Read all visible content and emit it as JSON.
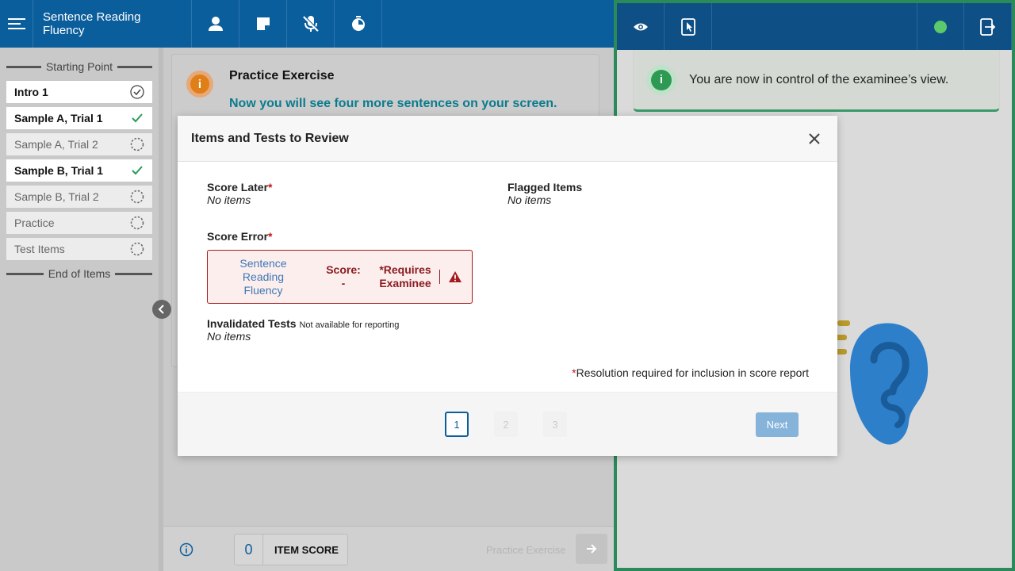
{
  "header": {
    "title": "Sentence Reading Fluency",
    "icons": [
      "menu-icon",
      "person-icon",
      "note-icon",
      "mic-off-icon",
      "timer-icon"
    ]
  },
  "sidebar": {
    "start_label": "Starting Point",
    "end_label": "End of Items",
    "items": [
      {
        "label": "Intro 1",
        "status": "circle-check"
      },
      {
        "label": "Sample A, Trial 1",
        "status": "check"
      },
      {
        "label": "Sample A, Trial 2",
        "status": "pending"
      },
      {
        "label": "Sample B, Trial 1",
        "status": "check"
      },
      {
        "label": "Sample B, Trial 2",
        "status": "pending"
      },
      {
        "label": "Practice",
        "status": "pending"
      },
      {
        "label": "Test Items",
        "status": "pending"
      }
    ]
  },
  "content": {
    "card_title": "Practice Exercise",
    "card_text": "Now you will see four more sentences on your screen."
  },
  "footer": {
    "item_score_value": "0",
    "item_score_label": "ITEM SCORE",
    "next_label": "Practice Exercise"
  },
  "examinee": {
    "notice": "You are now in control of the examinee’s view.",
    "status_color": "#5cc96b"
  },
  "modal": {
    "title": "Items and Tests to Review",
    "score_later_label": "Score Later",
    "score_later_value": "No items",
    "flagged_label": "Flagged Items",
    "flagged_value": "No items",
    "score_error_label": "Score Error",
    "score_error_row": {
      "test_line1": "Sentence",
      "test_line2": "Reading",
      "test_line3": "Fluency",
      "score_label": "Score:",
      "score_value": "-",
      "req_line1": "*Requires",
      "req_line2": "Examinee"
    },
    "invalidated_label": "Invalidated Tests",
    "invalidated_note": "Not available for reporting",
    "invalidated_value": "No items",
    "required_marker": "*",
    "resolution_note": "Resolution required for inclusion in score report",
    "pages": [
      "1",
      "2",
      "3"
    ],
    "active_page": "1",
    "next_button": "Next"
  }
}
